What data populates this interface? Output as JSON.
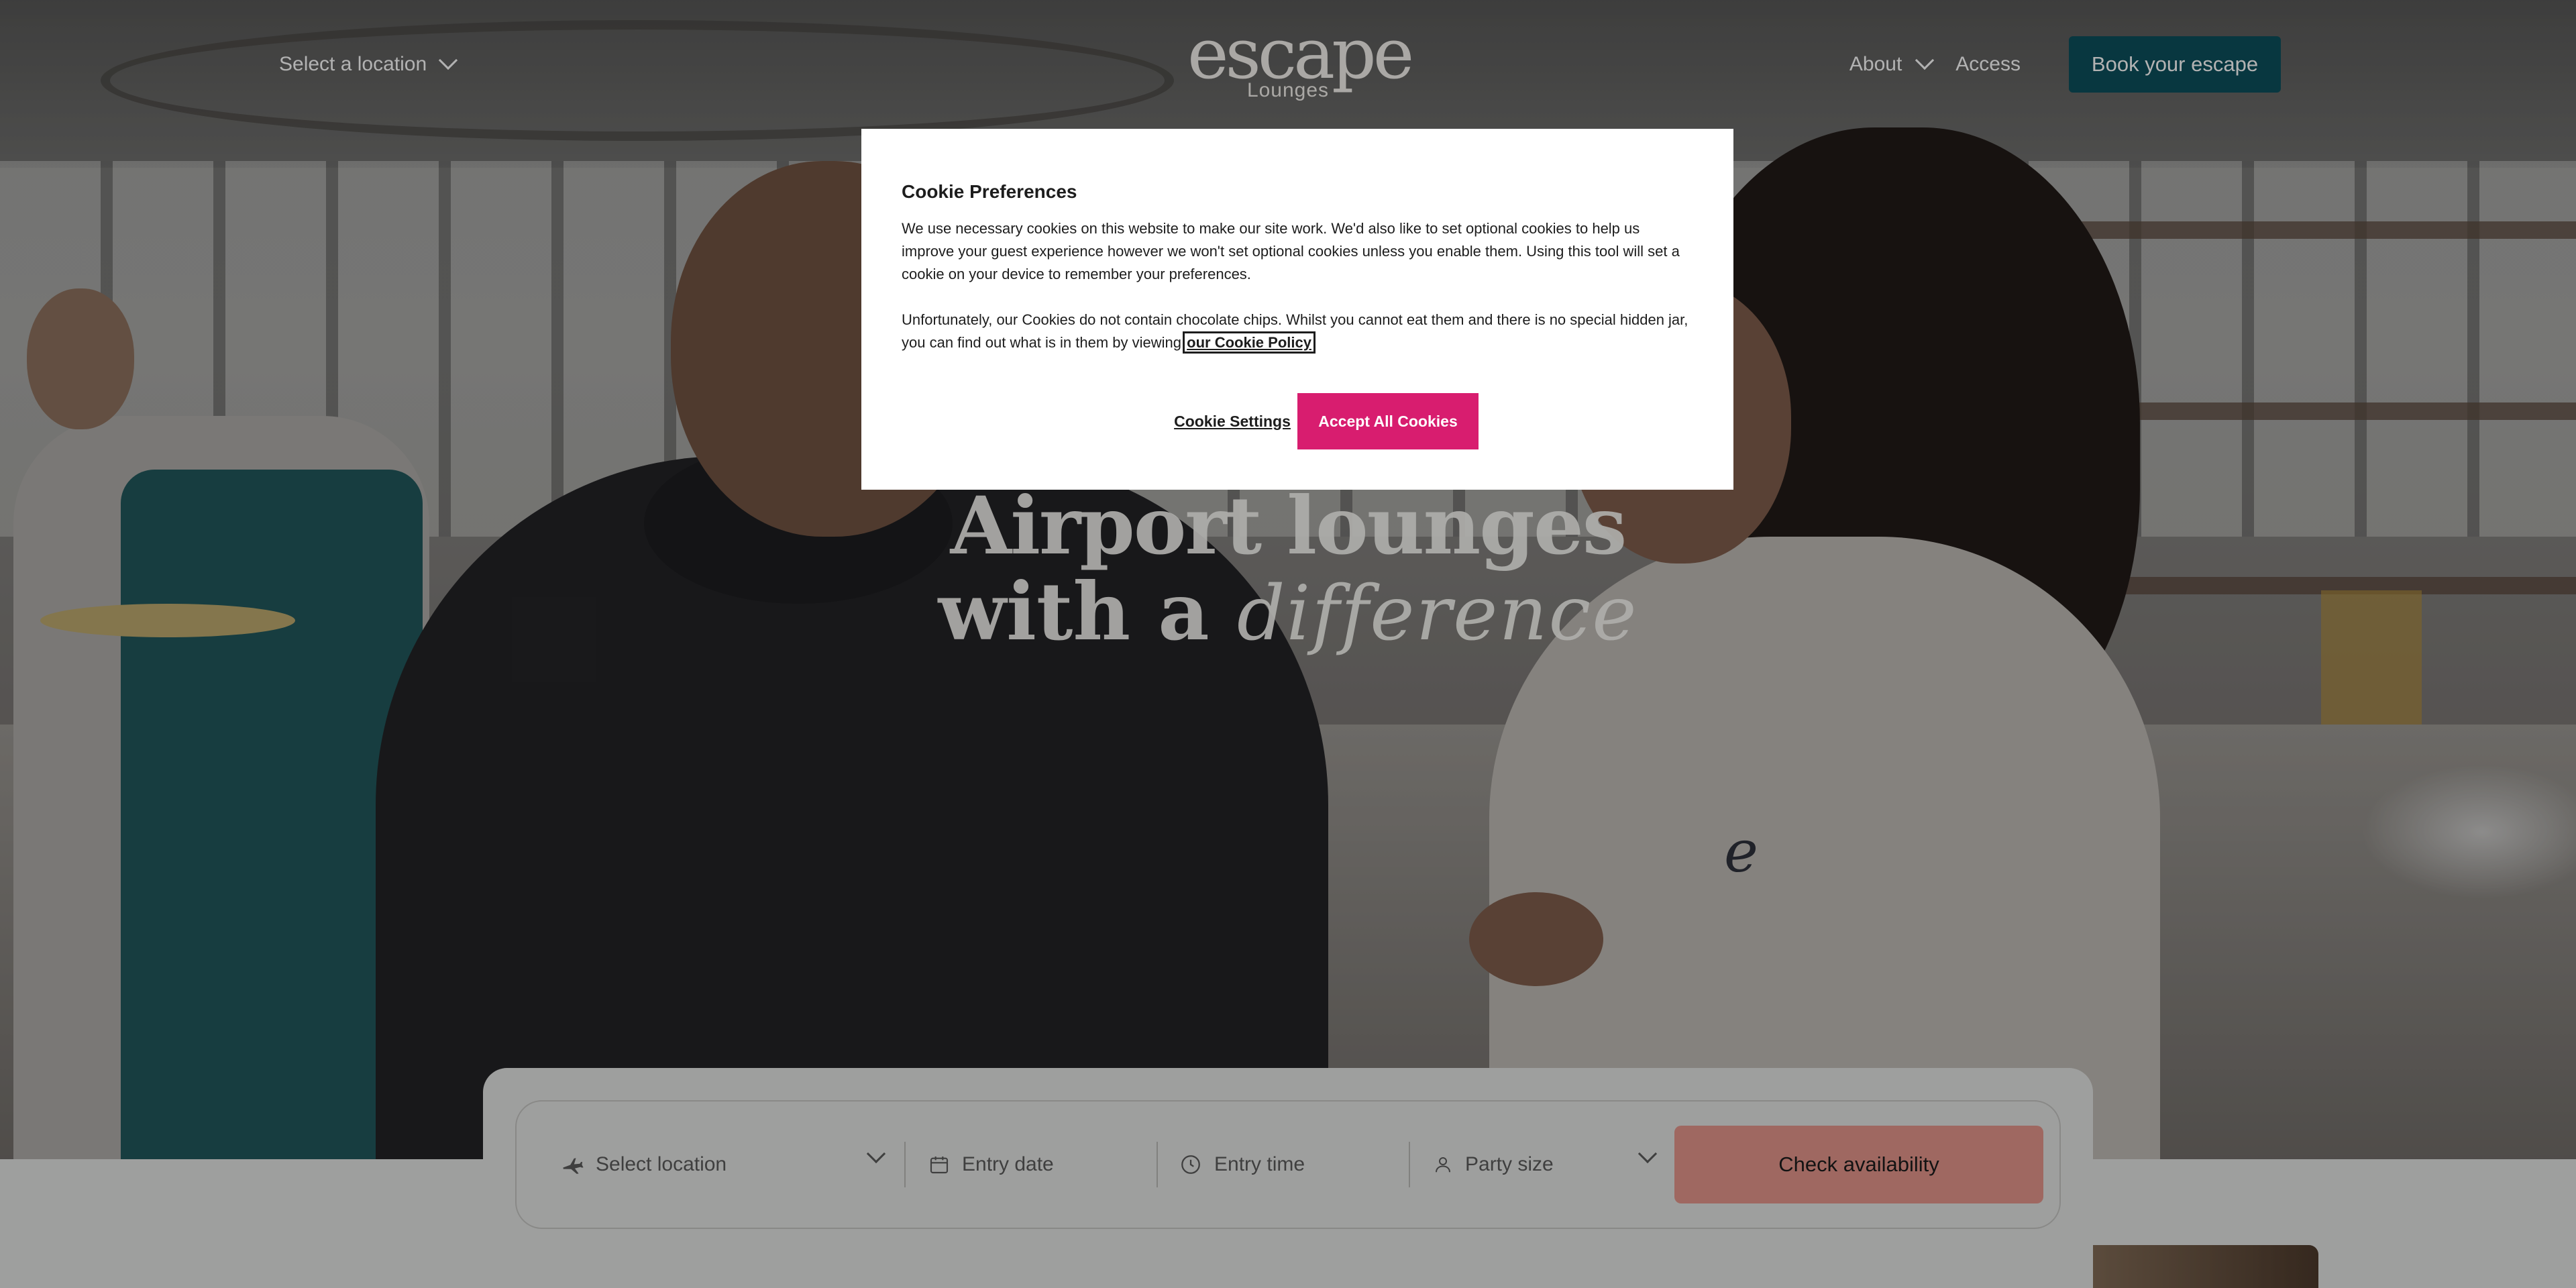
{
  "header": {
    "location_select": "Select a location",
    "logo": {
      "main": "escape",
      "sub": "Lounges"
    },
    "nav": {
      "about": "About",
      "access": "Access"
    },
    "book_button": "Book your escape"
  },
  "hero": {
    "line1": "Airport lounges",
    "line2": "with a",
    "script": "difference"
  },
  "booking": {
    "location_placeholder": "Select location",
    "date_placeholder": "Entry date",
    "time_placeholder": "Entry time",
    "party_placeholder": "Party size",
    "submit": "Check availability"
  },
  "cookie": {
    "title": "Cookie Preferences",
    "para1": "We use necessary cookies on this website to make our site work. We'd also like to set optional cookies to help us improve your guest experience however we won't set optional cookies unless you enable them. Using this tool will set a cookie on your device to remember your preferences.",
    "para2": "Unfortunately, our Cookies do not contain chocolate chips. Whilst you cannot eat them and there is no special hidden jar, you can find out what is in them by viewing",
    "policy_link": "our Cookie Policy",
    "settings_button": "Cookie Settings",
    "accept_button": "Accept All Cookies"
  },
  "colors": {
    "brand_teal": "#0c4f5c",
    "accent_coral": "#e4968b",
    "cookie_accept": "#d81d6f"
  },
  "icons": [
    "chevron-down-icon",
    "plane-icon",
    "calendar-icon",
    "clock-icon",
    "person-icon"
  ]
}
